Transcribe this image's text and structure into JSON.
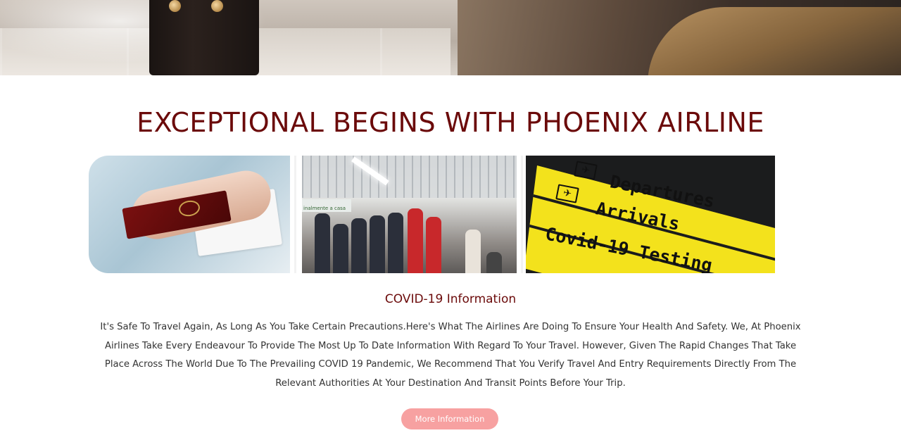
{
  "hero": {
    "image": "airport-luggage-banner"
  },
  "main": {
    "headline": "EXCEPTIONAL BEGINS WITH PHOENIX AIRLINE",
    "gallery": {
      "images": [
        "passport-hand-photo",
        "airport-terminal-crowd-photo",
        "departures-arrivals-sign-photo"
      ],
      "sign_lines": [
        "Departures",
        "Arrivals",
        "Covid-19 Testing"
      ],
      "terminal_sign": "inalmente a casa"
    },
    "covid_title": "COVID-19 Information",
    "covid_body": "It's Safe To Travel Again, As Long As You Take Certain Precautions.Here's What The Airlines Are Doing To Ensure Your Health And Safety. We, At Phoenix Airlines Take Every Endeavour To Provide The Most Up To Date Information With Regard To Your Travel. However, Given The Rapid Changes That Take Place Across The World Due To The Prevailing COVID 19 Pandemic, We Recommend That You Verify Travel And Entry Requirements Directly From The Relevant Authorities At Your Destination And Transit Points Before Your Trip.",
    "more_button": "More Information"
  },
  "colors": {
    "accent": "#6b0a0a",
    "button": "#f7a1a1",
    "sign_yellow": "#f3e21c"
  }
}
